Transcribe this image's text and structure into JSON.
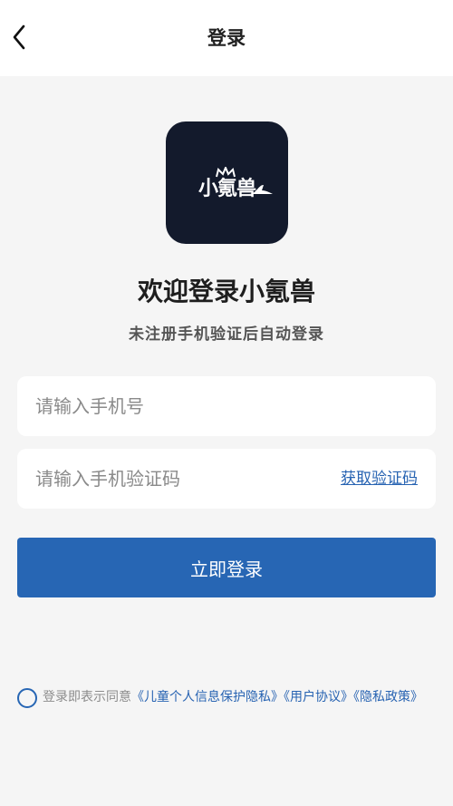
{
  "nav": {
    "title": "登录",
    "back_icon": "chevron-left-icon"
  },
  "logo": {
    "text": "小氪兽",
    "background_color": "#131a2c"
  },
  "welcome": {
    "title": "欢迎登录小氪兽",
    "subtitle": "未注册手机验证后自动登录"
  },
  "form": {
    "phone_placeholder": "请输入手机号",
    "phone_value": "",
    "code_placeholder": "请输入手机验证码",
    "code_value": "",
    "get_code_label": "获取验证码"
  },
  "login_button": {
    "label": "立即登录",
    "color": "#2766b4"
  },
  "agreement": {
    "checked": false,
    "prefix": "登录即表示同意",
    "link_child_privacy": "《儿童个人信息保护隐私》",
    "link_user_agreement": "《用户协议》",
    "link_privacy_policy": "《隐私政策》"
  },
  "colors": {
    "accent": "#2766b4",
    "link": "#2763b2",
    "background": "#f5f5f5"
  }
}
